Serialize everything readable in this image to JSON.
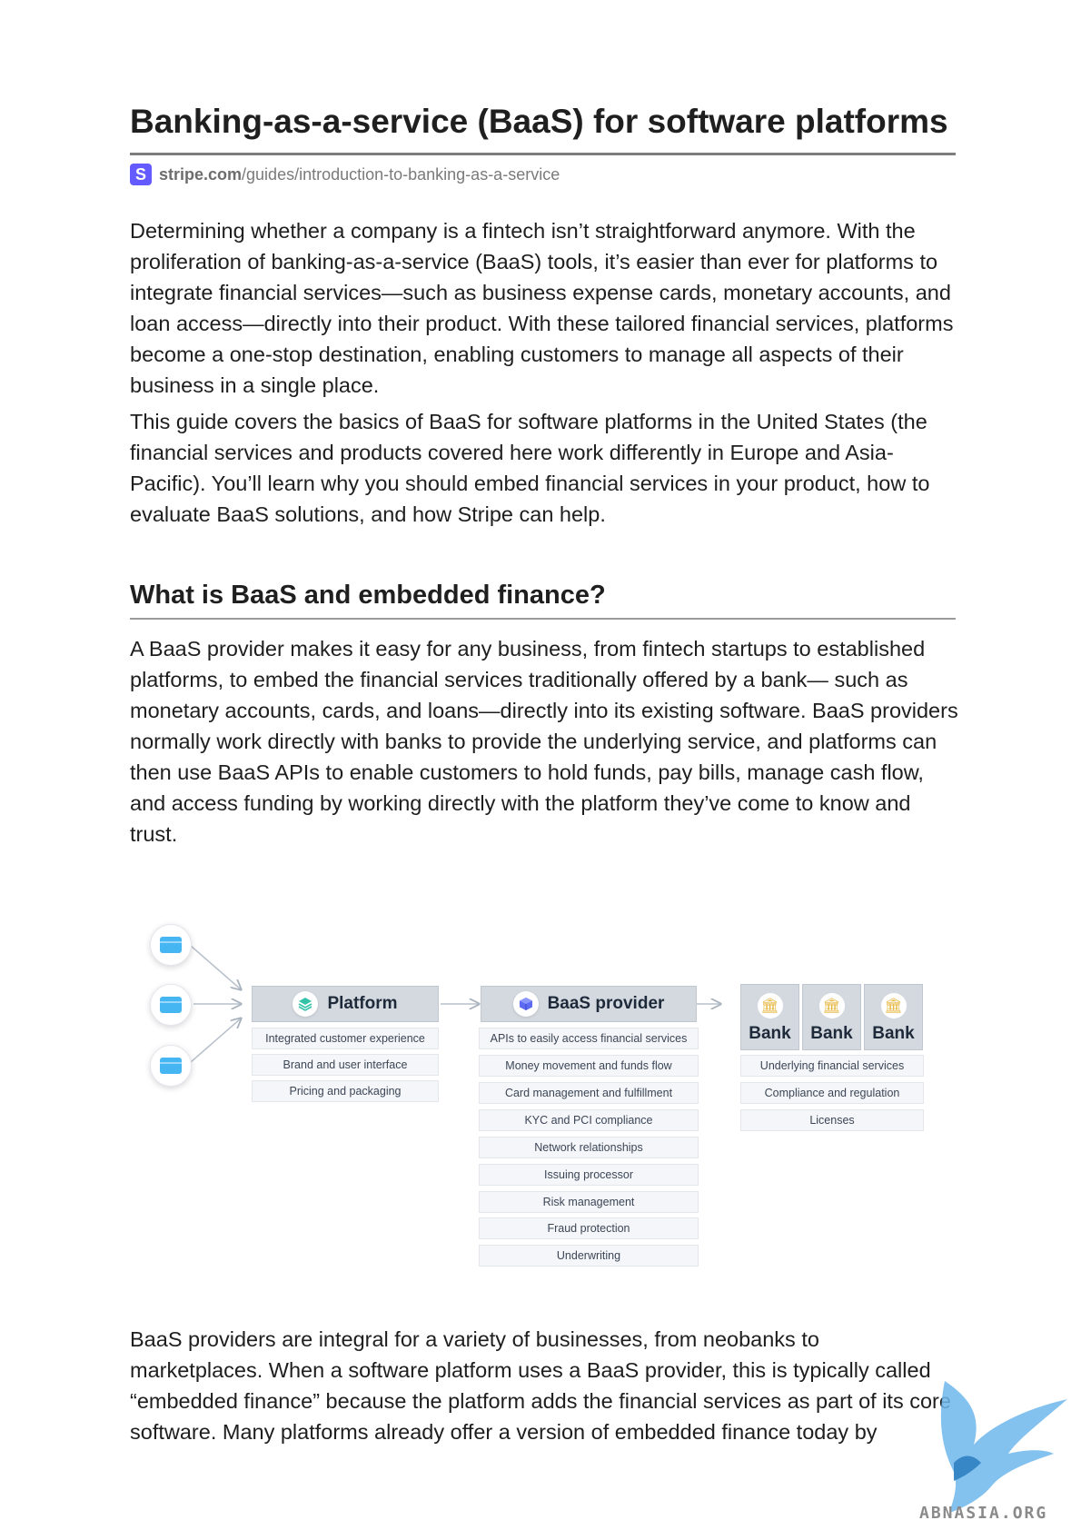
{
  "document": {
    "title": "Banking-as-a-service (BaaS) for software platforms",
    "source": {
      "logo_letter": "S",
      "domain": "stripe.com",
      "path": "/guides/introduction-to-banking-as-a-service"
    },
    "paragraphs": [
      "Determining whether a company is a fintech isn’t straightforward anymore. With the proliferation of banking-as-a-service (BaaS) tools, it’s easier than ever for platforms to integrate financial services—such as business expense cards, monetary accounts, and loan access—directly into their product. With these tailored financial services, platforms become a one-stop destination, enabling customers to manage all aspects of their business in a single place.",
      "This guide covers the basics of BaaS for software platforms in the United States (the financial services and products covered here work differently in Europe and Asia-Pacific). You’ll learn why you should embed financial services in your product, how to evaluate BaaS solutions, and how Stripe can help."
    ],
    "section_heading": "What is BaaS and embedded finance?",
    "section_paragraphs": [
      "A BaaS provider makes it easy for any business, from fintech startups to established platforms, to embed the financial services traditionally offered by a bank— such as monetary accounts, cards, and loans—directly into its existing software. BaaS providers normally work directly with banks to provide the underlying service, and platforms can then use BaaS APIs to enable customers to hold funds, pay bills, manage cash flow, and access funding by working directly with the platform they’ve come to know and trust.",
      "BaaS providers are integral for a variety of businesses, from neobanks to marketplaces. When a software platform uses a BaaS provider, this is typically called “embedded finance” because the platform adds the financial services as part of its core software. Many platforms already offer a version of embedded finance today by"
    ]
  },
  "diagram": {
    "platform": {
      "label": "Platform",
      "items": [
        "Integrated customer experience",
        "Brand and user interface",
        "Pricing and packaging"
      ]
    },
    "baas": {
      "label": "BaaS provider",
      "items": [
        "APIs to easily access financial services",
        "Money movement and funds flow",
        "Card management and fulfillment",
        "KYC and PCI compliance",
        "Network relationships",
        "Issuing processor",
        "Risk management",
        "Fraud protection",
        "Underwriting"
      ]
    },
    "banks": {
      "labels": [
        "Bank",
        "Bank",
        "Bank"
      ],
      "items": [
        "Underlying financial services",
        "Compliance and regulation",
        "Licenses"
      ]
    },
    "icons": {
      "customer": "credit-card-icon",
      "platform": "layers-icon",
      "baas": "cube-icon",
      "bank": "bank-building-icon"
    },
    "colors": {
      "header_bg": "#d4d9e0",
      "item_bg": "#f4f6f9",
      "customer_icon": "#46b6f3",
      "bank_icon": "#e6b53c"
    }
  },
  "watermark": {
    "text": "ABNASIA.ORG"
  }
}
